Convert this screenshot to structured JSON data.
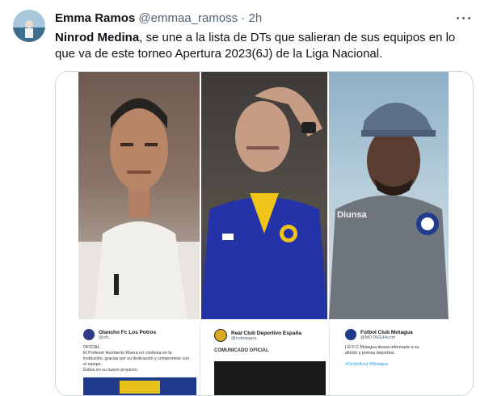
{
  "tweet": {
    "author_name": "Emma Ramos",
    "author_handle": "@emmaa_ramoss",
    "separator": "·",
    "time": "2h",
    "text_bold": "Ninrod Medina",
    "text_rest": ", se une a la lista de DTs que salieran de sus equipos en lo que va de este torneo Apertura 2023(6J) de la Liga Nacional."
  },
  "embedded": {
    "card1": {
      "club": "Olancho Fc Los Potros",
      "handle": "@ofc...",
      "lines": [
        "OFICIAL",
        "El Profesor Humberto Rivera no continúa en la",
        "institución, gracias por su dedicación y compromiso con",
        "el equipo.",
        "Éxitos en su nuevo proyecto."
      ]
    },
    "card2": {
      "club": "Real Club Deportivo España",
      "handle": "@rcdespana",
      "lines": [
        "COMUNICADO OFICIAL"
      ]
    },
    "card3": {
      "club": "Fútbol Club Motagua",
      "handle": "@MOTAGUAcom",
      "lines": [
        "| El F.C Motagua desea informarle a su",
        "afición y prensa deportiva.",
        "",
        "#CiclónAzul #Motagua"
      ]
    }
  },
  "colors": {
    "text": "#0f1419",
    "muted": "#536471",
    "border": "#cfd9de",
    "link": "#1d9bf0"
  },
  "icons": [
    "more-options-icon",
    "verified-badge-icon"
  ]
}
